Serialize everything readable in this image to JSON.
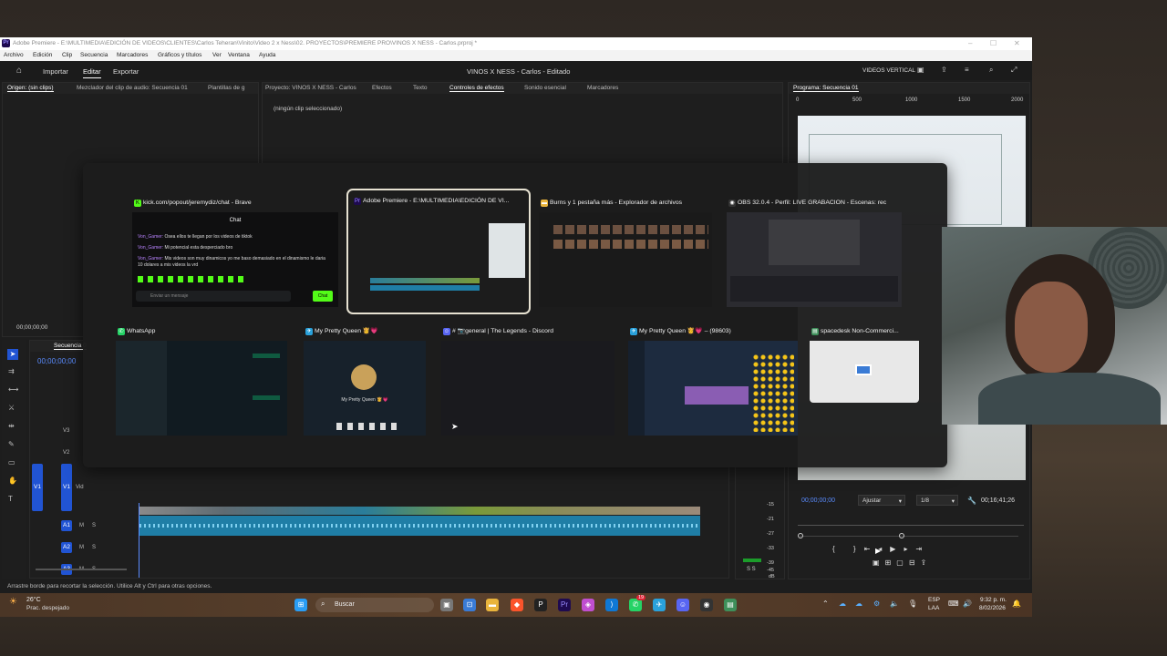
{
  "premiere": {
    "titlebar": {
      "logo": "Pr",
      "title": "Adobe Premiere - E:\\MULTIMEDIA\\EDICIÓN DE VIDEOS\\CLIENTES\\Carlos Teheran\\Vinito\\Video 2 x Ness\\02. PROYECTOS\\PREMIERE PRO\\VINOS X NESS - Carlos.prproj *"
    },
    "menu": [
      "Archivo",
      "Edición",
      "Clip",
      "Secuencia",
      "Marcadores",
      "Gráficos y títulos",
      "Ver",
      "Ventana",
      "Ayuda"
    ],
    "header": {
      "tabs": [
        "Importar",
        "Editar",
        "Exportar"
      ],
      "active_tab": "Editar",
      "project_title": "VINOS X NESS - Carlos - Editado",
      "workspace": "VIDEOS VERTICAL"
    },
    "source_tabs": [
      "Origen: (sin clips)",
      "Mezclador del clip de audio: Secuencia 01",
      "Plantillas de g"
    ],
    "center_tabs": [
      "Proyecto: VINOS X NESS - Carlos",
      "Efectos",
      "Texto",
      "Controles de efectos",
      "Sonido esencial",
      "Marcadores"
    ],
    "center_active": "Controles de efectos",
    "effect_controls_empty": "(ningún clip seleccionado)",
    "program_tab": "Programa: Secuencia 01",
    "program_ruler": [
      "0",
      "500",
      "1000",
      "1500",
      "2000"
    ],
    "source_timecode": "00;00;00;00",
    "timeline_tab": "Secuencia 0",
    "timeline_timecode": "00;00;00;00",
    "tracks_video": [
      "V3",
      "V2",
      "V1"
    ],
    "tracks_audio": [
      "A1",
      "A2",
      "A3",
      "A4"
    ],
    "v1_source": "V1",
    "video_label": "Vid",
    "track_m": "M",
    "track_s": "S",
    "meter_scale": [
      "-15",
      "-21",
      "-27",
      "-33",
      "-39",
      "-45",
      "dB"
    ],
    "meter_ss": "S S",
    "program_timecode": "00;00;00;00",
    "fit": "Ajustar",
    "resolution": "1/8",
    "duration": "00;16;41;26",
    "status": "Arrastre borde para recortar la selección. Utilice Alt y Ctrl para otras opciones."
  },
  "alt_tab": {
    "windows": [
      {
        "title": "kick.com/popout/jeremydiz/chat - Brave",
        "icon": "kick-icon",
        "chat": {
          "header": "Chat",
          "messages": [
            {
              "user": "Von_Gamer:",
              "text": "Osea ellos te llegan por los videos de tiktok"
            },
            {
              "user": "Von_Gamer:",
              "text": "Mi potencial esta desperciado bro"
            },
            {
              "user": "Von_Gamer:",
              "text": "Mis videos son muy dinamicos yo me baso demasiado en el dinamismo le daria 10 dolares a mis videos la vrd"
            }
          ],
          "input_placeholder": "Enviar un mensaje",
          "send_label": "Chat"
        }
      },
      {
        "title": "Adobe Premiere - E:\\MULTIMEDIA\\EDICIÓN DE VI...",
        "icon": "premiere-icon",
        "selected": true
      },
      {
        "title": "Burns y 1 pestaña más - Explorador de archivos",
        "icon": "folder-icon"
      },
      {
        "title": "OBS 32.0.4 - Perfil: LIVE GRABACION - Escenas: rec",
        "icon": "obs-icon"
      },
      {
        "title": "WhatsApp",
        "icon": "whatsapp-icon"
      },
      {
        "title": "My Pretty Queen 👸💗",
        "icon": "telegram-icon",
        "profile_caption": "My Pretty Queen 👸💗"
      },
      {
        "title": "# 📷general | The Legends - Discord",
        "icon": "discord-icon"
      },
      {
        "title": "My Pretty Queen 👸💗 – (98603)",
        "icon": "telegram-icon"
      },
      {
        "title": "spacedesk Non-Commerci...",
        "icon": "spacedesk-icon"
      }
    ]
  },
  "taskbar": {
    "weather_temp": "26°C",
    "weather_desc": "Prac. despejado",
    "search_placeholder": "Buscar",
    "lang_top": "ESP",
    "lang_bottom": "LAA",
    "time": "9:32 p. m.",
    "date": "8/02/2026",
    "badge_whatsapp": "19"
  }
}
